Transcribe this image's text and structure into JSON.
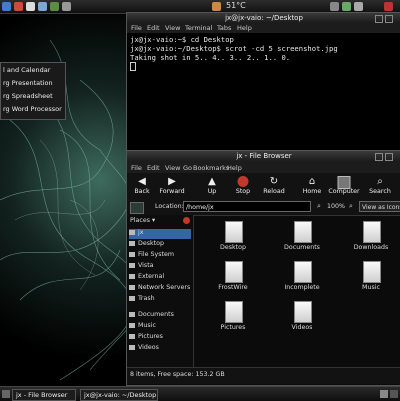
{
  "top_panel": {
    "temperature": "51°C"
  },
  "app_menu": {
    "items": [
      "l and Calendar",
      "rg Presentation",
      "rg Spreadsheet",
      "rg Word Processor"
    ]
  },
  "terminal": {
    "title": "jx@jx-vaio: ~/Desktop",
    "menu": [
      "File",
      "Edit",
      "View",
      "Terminal",
      "Tabs",
      "Help"
    ],
    "lines": [
      "jx@jx-vaio:~$ cd Desktop",
      "jx@jx-vaio:~/Desktop$ scrot -cd 5 screenshot.jpg",
      "Taking shot in 5.. 4.. 3.. 2.. 1.. 0."
    ]
  },
  "file_browser": {
    "title": "jx - File Browser",
    "menu": [
      "File",
      "Edit",
      "View",
      "Go",
      "Bookmarks",
      "Help"
    ],
    "toolbar": {
      "back": "Back",
      "forward": "Forward",
      "up": "Up",
      "stop": "Stop",
      "reload": "Reload",
      "home": "Home",
      "computer": "Computer",
      "search": "Search"
    },
    "location_label": "Location:",
    "location_value": "/home/jx",
    "zoom": "100%",
    "view_mode": "View as Icons",
    "places_label": "Places",
    "places": [
      "jx",
      "Desktop",
      "File System",
      "Vista",
      "External",
      "Network Servers",
      "Trash",
      "Documents",
      "Music",
      "Pictures",
      "Videos"
    ],
    "files": [
      "Desktop",
      "Documents",
      "Downloads",
      "FrostWire",
      "Incomplete",
      "Music",
      "Pictures",
      "Videos"
    ],
    "status": "8 items, Free space: 153.2 GB"
  },
  "taskbar": {
    "items": [
      "jx - File Browser",
      "jx@jx-vaio: ~/Desktop"
    ]
  }
}
